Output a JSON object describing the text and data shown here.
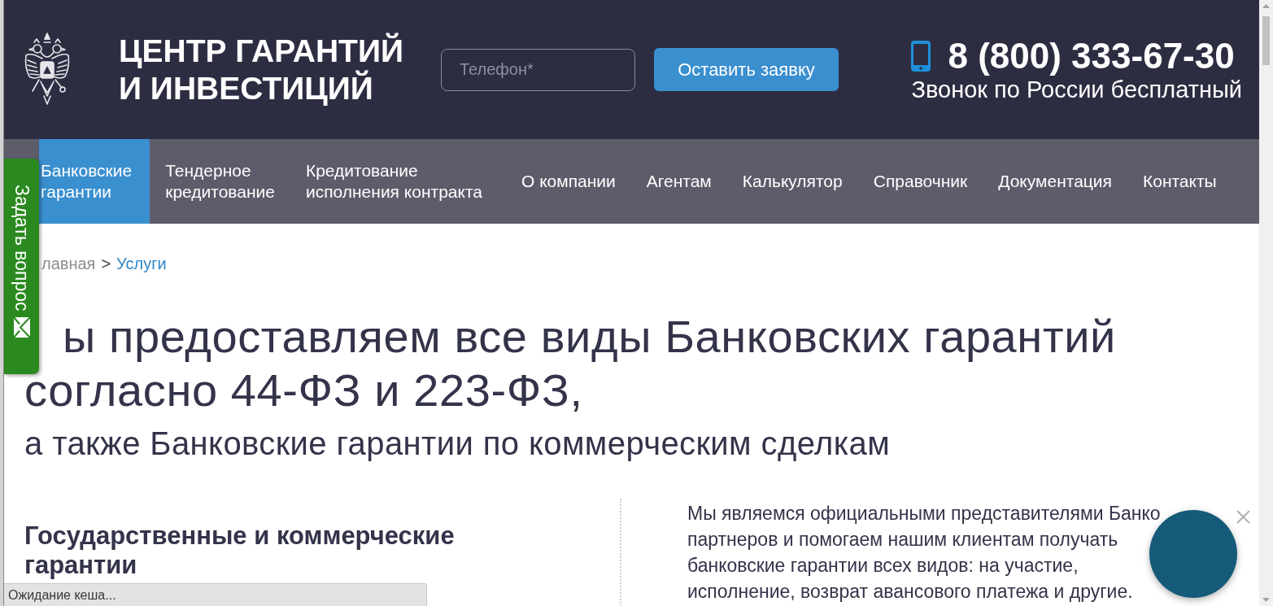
{
  "header": {
    "title_lines": [
      "ЦЕНТР ГАРАНТИЙ",
      "И ИНВЕСТИЦИЙ"
    ],
    "phone_field": {
      "placeholder": "Телефон*"
    },
    "submit_button": "Оставить заявку",
    "phone_number": "8 (800) 333-67-30",
    "phone_note": "Звонок по России бесплатный"
  },
  "nav": {
    "items": [
      {
        "lines": [
          "Банковские",
          "гарантии"
        ],
        "selected": true
      },
      {
        "lines": [
          "Тендерное",
          "кредитование"
        ],
        "selected": false
      },
      {
        "lines": [
          "Кредитование",
          "исполнения контракта"
        ],
        "selected": false
      },
      {
        "lines": [
          "О компании"
        ],
        "selected": false
      },
      {
        "lines": [
          "Агентам"
        ],
        "selected": false
      },
      {
        "lines": [
          "Калькулятор"
        ],
        "selected": false
      },
      {
        "lines": [
          "Справочник"
        ],
        "selected": false
      },
      {
        "lines": [
          "Документация"
        ],
        "selected": false
      },
      {
        "lines": [
          "Контакты"
        ],
        "selected": false
      }
    ]
  },
  "side_tab": {
    "label": "Задать вопрос"
  },
  "breadcrumb": {
    "items": [
      {
        "label": "лавная",
        "kind": "muted"
      },
      {
        "label": "Услуги",
        "kind": "link"
      }
    ],
    "separator": ">"
  },
  "hero": {
    "title_lines": [
      "ы предоставляем все виды Банковских гарантий",
      "согласно 44-ФЗ и 223-ФЗ,"
    ],
    "subtitle": "а также Банковские гарантии по коммерческим сделкам"
  },
  "section": {
    "heading_lines": [
      "Государственные и коммерческие",
      "гарантии"
    ],
    "paragraph_lines": [
      "Мы являемся официальными представителями Банко",
      "партнеров и помогаем нашим клиентам получать",
      "банковские гарантии всех видов: на участие,",
      "исполнение, возврат авансового платежа и другие."
    ]
  },
  "status_bar": {
    "text": "Ожидание кеша..."
  }
}
